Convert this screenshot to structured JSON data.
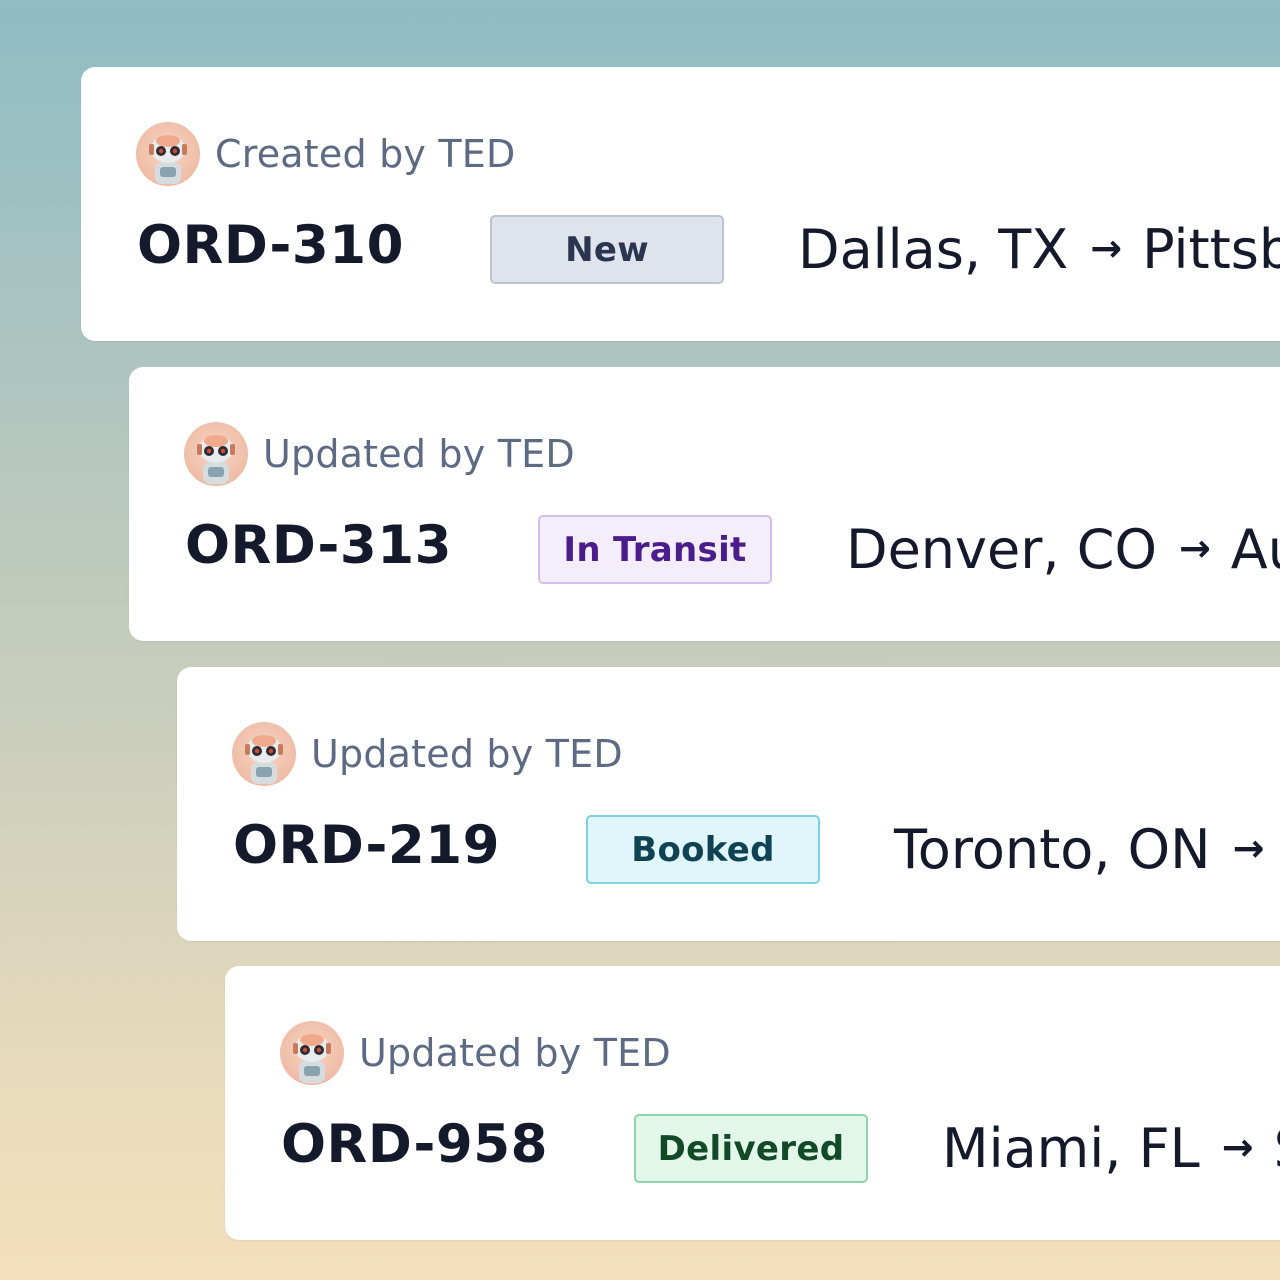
{
  "cards": [
    {
      "author": "Created by TED",
      "order_id": "ORD-310",
      "status": "New",
      "origin": "Dallas, TX",
      "destination": "Pittsb"
    },
    {
      "author": "Updated by TED",
      "order_id": "ORD-313",
      "status": "In Transit",
      "origin": "Denver, CO",
      "destination": "Au"
    },
    {
      "author": "Updated by TED",
      "order_id": "ORD-219",
      "status": "Booked",
      "origin": "Toronto, ON",
      "destination": ""
    },
    {
      "author": "Updated by TED",
      "order_id": "ORD-958",
      "status": "Delivered",
      "origin": "Miami, FL",
      "destination": "S"
    }
  ],
  "route_arrow": "→",
  "icons": {
    "avatar": "robot-avatar-icon",
    "arrow": "arrow-right-icon"
  },
  "status_colors": {
    "New": "#dfe3ec",
    "In Transit": "#f4edfc",
    "Booked": "#e1f6fb",
    "Delivered": "#e3f6ea"
  }
}
